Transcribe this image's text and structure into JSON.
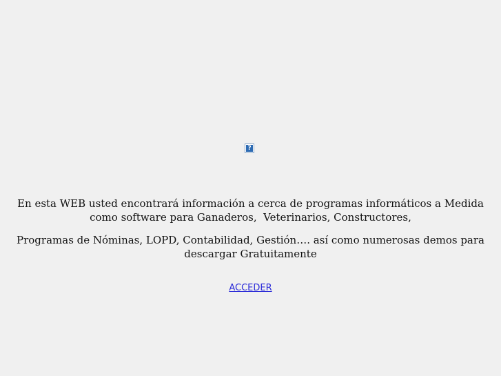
{
  "header": {
    "image_icon": "broken-image-icon"
  },
  "intro": {
    "line1": "En esta WEB usted encontrará información a cerca de programas informáticos a Medida",
    "line2": "como software para Ganaderos,  Veterinarios, Constructores,",
    "line3": "Programas de Nóminas, LOPD, Contabilidad, Gestión…. así como numerosas demos para",
    "line4": "descargar Gratuitamente"
  },
  "nav": {
    "enter_label": "ACCEDER"
  },
  "colors": {
    "background": "#f0f0f0",
    "link": "#2a2ad8"
  }
}
